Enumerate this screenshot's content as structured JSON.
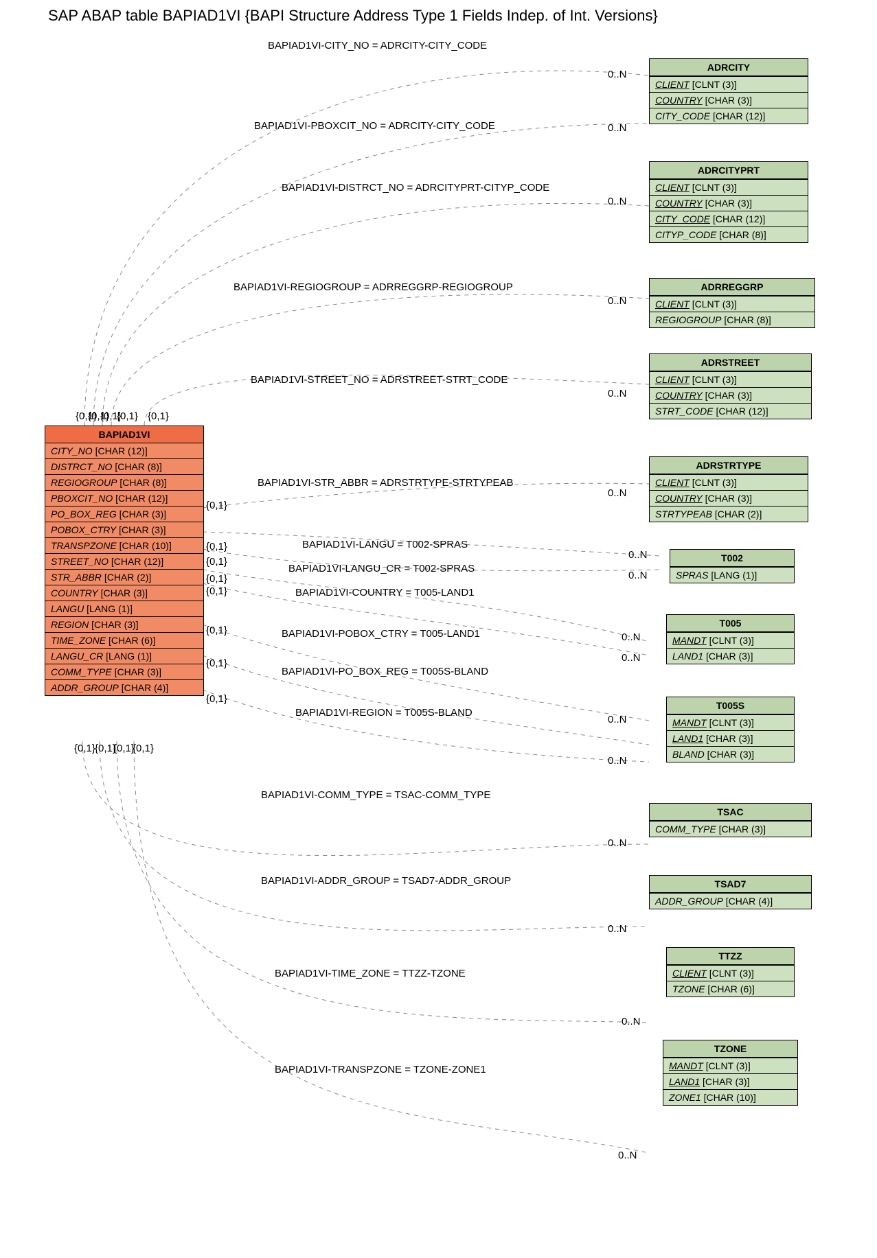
{
  "title": "SAP ABAP table BAPIAD1VI {BAPI Structure Address Type 1 Fields Indep. of Int. Versions}",
  "main_table": {
    "name": "BAPIAD1VI",
    "fields": [
      {
        "f": "CITY_NO",
        "t": "[CHAR (12)]"
      },
      {
        "f": "DISTRCT_NO",
        "t": "[CHAR (8)]"
      },
      {
        "f": "REGIOGROUP",
        "t": "[CHAR (8)]"
      },
      {
        "f": "PBOXCIT_NO",
        "t": "[CHAR (12)]"
      },
      {
        "f": "PO_BOX_REG",
        "t": "[CHAR (3)]"
      },
      {
        "f": "POBOX_CTRY",
        "t": "[CHAR (3)]"
      },
      {
        "f": "TRANSPZONE",
        "t": "[CHAR (10)]"
      },
      {
        "f": "STREET_NO",
        "t": "[CHAR (12)]"
      },
      {
        "f": "STR_ABBR",
        "t": "[CHAR (2)]"
      },
      {
        "f": "COUNTRY",
        "t": "[CHAR (3)]"
      },
      {
        "f": "LANGU",
        "t": "[LANG (1)]"
      },
      {
        "f": "REGION",
        "t": "[CHAR (3)]"
      },
      {
        "f": "TIME_ZONE",
        "t": "[CHAR (6)]"
      },
      {
        "f": "LANGU_CR",
        "t": "[LANG (1)]"
      },
      {
        "f": "COMM_TYPE",
        "t": "[CHAR (3)]"
      },
      {
        "f": "ADDR_GROUP",
        "t": "[CHAR (4)]"
      }
    ]
  },
  "ref_tables": [
    {
      "name": "ADRCITY",
      "fields": [
        {
          "f": "CLIENT",
          "t": "[CLNT (3)]",
          "u": true
        },
        {
          "f": "COUNTRY",
          "t": "[CHAR (3)]",
          "u": true
        },
        {
          "f": "CITY_CODE",
          "t": "[CHAR (12)]",
          "u": false
        }
      ]
    },
    {
      "name": "ADRCITYPRT",
      "fields": [
        {
          "f": "CLIENT",
          "t": "[CLNT (3)]",
          "u": true
        },
        {
          "f": "COUNTRY",
          "t": "[CHAR (3)]",
          "u": true
        },
        {
          "f": "CITY_CODE",
          "t": "[CHAR (12)]",
          "u": true
        },
        {
          "f": "CITYP_CODE",
          "t": "[CHAR (8)]",
          "u": false
        }
      ]
    },
    {
      "name": "ADRREGGRP",
      "fields": [
        {
          "f": "CLIENT",
          "t": "[CLNT (3)]",
          "u": true
        },
        {
          "f": "REGIOGROUP",
          "t": "[CHAR (8)]",
          "u": false
        }
      ]
    },
    {
      "name": "ADRSTREET",
      "fields": [
        {
          "f": "CLIENT",
          "t": "[CLNT (3)]",
          "u": true
        },
        {
          "f": "COUNTRY",
          "t": "[CHAR (3)]",
          "u": true
        },
        {
          "f": "STRT_CODE",
          "t": "[CHAR (12)]",
          "u": false
        }
      ]
    },
    {
      "name": "ADRSTRTYPE",
      "fields": [
        {
          "f": "CLIENT",
          "t": "[CLNT (3)]",
          "u": true
        },
        {
          "f": "COUNTRY",
          "t": "[CHAR (3)]",
          "u": true
        },
        {
          "f": "STRTYPEAB",
          "t": "[CHAR (2)]",
          "u": false
        }
      ]
    },
    {
      "name": "T002",
      "fields": [
        {
          "f": "SPRAS",
          "t": "[LANG (1)]",
          "u": false
        }
      ]
    },
    {
      "name": "T005",
      "fields": [
        {
          "f": "MANDT",
          "t": "[CLNT (3)]",
          "u": true
        },
        {
          "f": "LAND1",
          "t": "[CHAR (3)]",
          "u": false
        }
      ]
    },
    {
      "name": "T005S",
      "fields": [
        {
          "f": "MANDT",
          "t": "[CLNT (3)]",
          "u": true
        },
        {
          "f": "LAND1",
          "t": "[CHAR (3)]",
          "u": true
        },
        {
          "f": "BLAND",
          "t": "[CHAR (3)]",
          "u": false
        }
      ]
    },
    {
      "name": "TSAC",
      "fields": [
        {
          "f": "COMM_TYPE",
          "t": "[CHAR (3)]",
          "u": false
        }
      ]
    },
    {
      "name": "TSAD7",
      "fields": [
        {
          "f": "ADDR_GROUP",
          "t": "[CHAR (4)]",
          "u": false
        }
      ]
    },
    {
      "name": "TTZZ",
      "fields": [
        {
          "f": "CLIENT",
          "t": "[CLNT (3)]",
          "u": true
        },
        {
          "f": "TZONE",
          "t": "[CHAR (6)]",
          "u": false
        }
      ]
    },
    {
      "name": "TZONE",
      "fields": [
        {
          "f": "MANDT",
          "t": "[CLNT (3)]",
          "u": true
        },
        {
          "f": "LAND1",
          "t": "[CHAR (3)]",
          "u": true
        },
        {
          "f": "ZONE1",
          "t": "[CHAR (10)]",
          "u": false
        }
      ]
    }
  ],
  "relations": [
    {
      "label": "BAPIAD1VI-CITY_NO = ADRCITY-CITY_CODE"
    },
    {
      "label": "BAPIAD1VI-PBOXCIT_NO = ADRCITY-CITY_CODE"
    },
    {
      "label": "BAPIAD1VI-DISTRCT_NO = ADRCITYPRT-CITYP_CODE"
    },
    {
      "label": "BAPIAD1VI-REGIOGROUP = ADRREGGRP-REGIOGROUP"
    },
    {
      "label": "BAPIAD1VI-STREET_NO = ADRSTREET-STRT_CODE"
    },
    {
      "label": "BAPIAD1VI-STR_ABBR = ADRSTRTYPE-STRTYPEAB"
    },
    {
      "label": "BAPIAD1VI-LANGU = T002-SPRAS"
    },
    {
      "label": "BAPIAD1VI-LANGU_CR = T002-SPRAS"
    },
    {
      "label": "BAPIAD1VI-COUNTRY = T005-LAND1"
    },
    {
      "label": "BAPIAD1VI-POBOX_CTRY = T005-LAND1"
    },
    {
      "label": "BAPIAD1VI-PO_BOX_REG = T005S-BLAND"
    },
    {
      "label": "BAPIAD1VI-REGION = T005S-BLAND"
    },
    {
      "label": "BAPIAD1VI-COMM_TYPE = TSAC-COMM_TYPE"
    },
    {
      "label": "BAPIAD1VI-ADDR_GROUP = TSAD7-ADDR_GROUP"
    },
    {
      "label": "BAPIAD1VI-TIME_ZONE = TTZZ-TZONE"
    },
    {
      "label": "BAPIAD1VI-TRANSPZONE = TZONE-ZONE1"
    }
  ],
  "top_cards": [
    "{0,1}",
    "{0,1}",
    "{0,1}",
    "{0,1}",
    "{0,1}"
  ],
  "right_side_cards": [
    "{0,1}",
    "{0,1}",
    "{0,1}",
    "{0,1}",
    "{0,1}",
    "{0,1}",
    "{0,1}",
    "{0,1}"
  ],
  "bottom_cards": [
    "{0,1}",
    "{0,1}",
    "{0,1}",
    "{0,1}"
  ],
  "right_far_cards": [
    "0..N",
    "0..N",
    "0..N",
    "0..N",
    "0..N",
    "0..N",
    "0..N",
    "0..N",
    "0..N",
    "0..N",
    "0..N",
    "0..N",
    "0..N",
    "0..N",
    "0..N",
    "0..N"
  ],
  "chart_data": {
    "type": "erd",
    "main": "BAPIAD1VI",
    "relations": [
      {
        "from": "BAPIAD1VI.CITY_NO",
        "to": "ADRCITY.CITY_CODE",
        "card_from": "{0,1}",
        "card_to": "0..N"
      },
      {
        "from": "BAPIAD1VI.PBOXCIT_NO",
        "to": "ADRCITY.CITY_CODE",
        "card_from": "{0,1}",
        "card_to": "0..N"
      },
      {
        "from": "BAPIAD1VI.DISTRCT_NO",
        "to": "ADRCITYPRT.CITYP_CODE",
        "card_from": "{0,1}",
        "card_to": "0..N"
      },
      {
        "from": "BAPIAD1VI.REGIOGROUP",
        "to": "ADRREGGRP.REGIOGROUP",
        "card_from": "{0,1}",
        "card_to": "0..N"
      },
      {
        "from": "BAPIAD1VI.STREET_NO",
        "to": "ADRSTREET.STRT_CODE",
        "card_from": "{0,1}",
        "card_to": "0..N"
      },
      {
        "from": "BAPIAD1VI.STR_ABBR",
        "to": "ADRSTRTYPE.STRTYPEAB",
        "card_from": "{0,1}",
        "card_to": "0..N"
      },
      {
        "from": "BAPIAD1VI.LANGU",
        "to": "T002.SPRAS",
        "card_from": "{0,1}",
        "card_to": "0..N"
      },
      {
        "from": "BAPIAD1VI.LANGU_CR",
        "to": "T002.SPRAS",
        "card_from": "{0,1}",
        "card_to": "0..N"
      },
      {
        "from": "BAPIAD1VI.COUNTRY",
        "to": "T005.LAND1",
        "card_from": "{0,1}",
        "card_to": "0..N"
      },
      {
        "from": "BAPIAD1VI.POBOX_CTRY",
        "to": "T005.LAND1",
        "card_from": "{0,1}",
        "card_to": "0..N"
      },
      {
        "from": "BAPIAD1VI.PO_BOX_REG",
        "to": "T005S.BLAND",
        "card_from": "{0,1}",
        "card_to": "0..N"
      },
      {
        "from": "BAPIAD1VI.REGION",
        "to": "T005S.BLAND",
        "card_from": "{0,1}",
        "card_to": "0..N"
      },
      {
        "from": "BAPIAD1VI.COMM_TYPE",
        "to": "TSAC.COMM_TYPE",
        "card_from": "{0,1}",
        "card_to": "0..N"
      },
      {
        "from": "BAPIAD1VI.ADDR_GROUP",
        "to": "TSAD7.ADDR_GROUP",
        "card_from": "{0,1}",
        "card_to": "0..N"
      },
      {
        "from": "BAPIAD1VI.TIME_ZONE",
        "to": "TTZZ.TZONE",
        "card_from": "{0,1}",
        "card_to": "0..N"
      },
      {
        "from": "BAPIAD1VI.TRANSPZONE",
        "to": "TZONE.ZONE1",
        "card_from": "{0,1}",
        "card_to": "0..N"
      }
    ]
  }
}
